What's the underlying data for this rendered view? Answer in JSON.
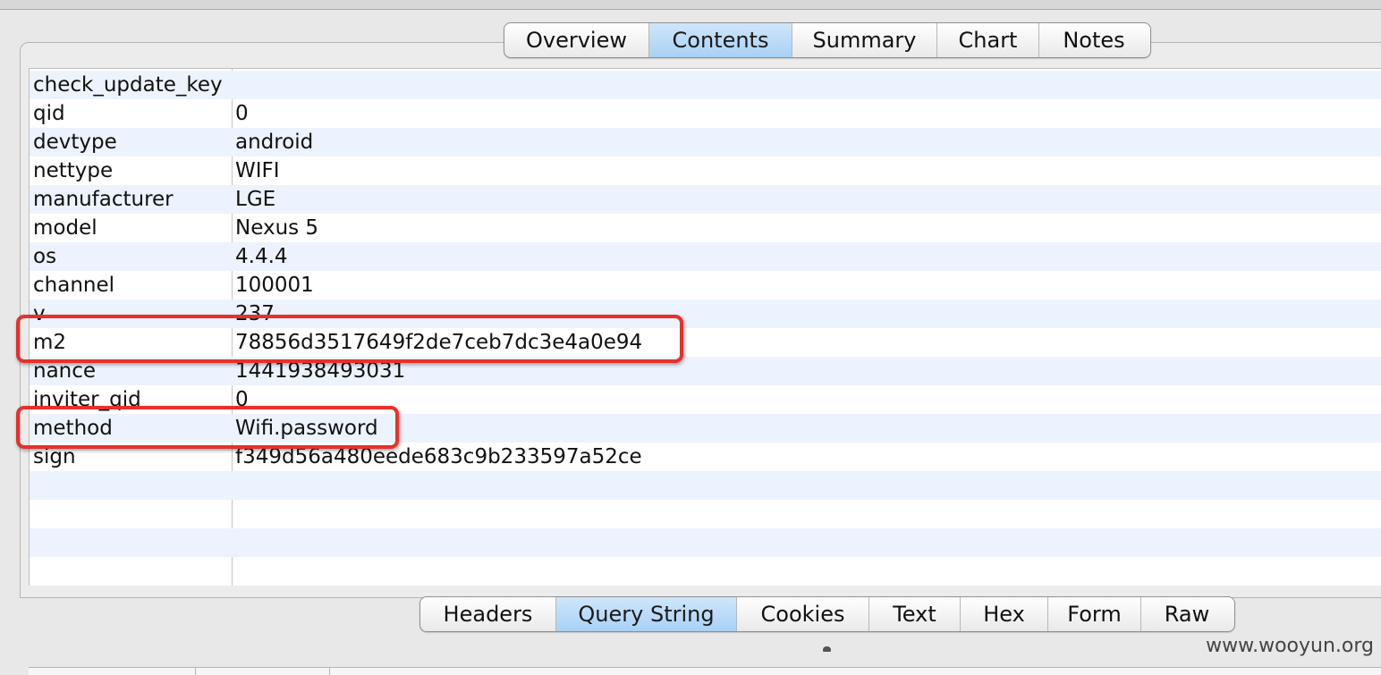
{
  "top_tabs": [
    {
      "label": "Overview",
      "active": false
    },
    {
      "label": "Contents",
      "active": true
    },
    {
      "label": "Summary",
      "active": false
    },
    {
      "label": "Chart",
      "active": false
    },
    {
      "label": "Notes",
      "active": false
    }
  ],
  "rows": [
    {
      "key": "check_update_key",
      "value": ""
    },
    {
      "key": "qid",
      "value": "0"
    },
    {
      "key": "devtype",
      "value": "android"
    },
    {
      "key": "nettype",
      "value": "WIFI"
    },
    {
      "key": "manufacturer",
      "value": "LGE"
    },
    {
      "key": "model",
      "value": "Nexus 5"
    },
    {
      "key": "os",
      "value": "4.4.4"
    },
    {
      "key": "channel",
      "value": "100001"
    },
    {
      "key": "v",
      "value": "237"
    },
    {
      "key": "m2",
      "value": "78856d3517649f2de7ceb7dc3e4a0e94"
    },
    {
      "key": "nance",
      "value": "1441938493031"
    },
    {
      "key": "inviter_qid",
      "value": "0"
    },
    {
      "key": "method",
      "value": "Wifi.password"
    },
    {
      "key": "sign",
      "value": "f349d56a480eede683c9b233597a52ce"
    }
  ],
  "highlight_color": "#e8302a",
  "bottom_tabs": [
    {
      "label": "Headers",
      "active": false
    },
    {
      "label": "Query String",
      "active": true
    },
    {
      "label": "Cookies",
      "active": false
    },
    {
      "label": "Text",
      "active": false
    },
    {
      "label": "Hex",
      "active": false
    },
    {
      "label": "Form",
      "active": false
    },
    {
      "label": "Raw",
      "active": false
    }
  ],
  "watermark": "www.wooyun.org"
}
